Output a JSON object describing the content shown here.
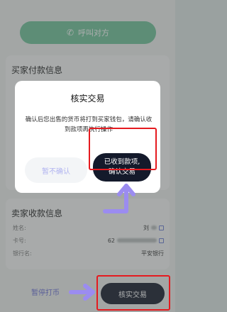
{
  "call_button": {
    "label": "呼叫对方",
    "icon": "phone-icon"
  },
  "buyer_section": {
    "title": "买家付款信息"
  },
  "seller_section": {
    "title": "卖家收款信息",
    "rows": [
      {
        "label": "姓名:",
        "value": "刘"
      },
      {
        "label": "卡号:",
        "value": "62"
      },
      {
        "label": "银行名:",
        "value": "平安银行"
      }
    ]
  },
  "bottom": {
    "pause_label": "暂停打币",
    "confirm_label": "核实交易"
  },
  "dialog": {
    "title": "核实交易",
    "message": "确认后您出售的货币将打到买家钱包，请确认收到款项再执行操作",
    "cancel_label": "暂不确认",
    "confirm_line1": "已收到款项,",
    "confirm_line2": "确认交易"
  },
  "colors": {
    "accent_green": "#6fc49a",
    "dark_button": "#141a2b",
    "annotation_red": "#e51a1f",
    "annotation_purple": "#9b8cf0"
  }
}
